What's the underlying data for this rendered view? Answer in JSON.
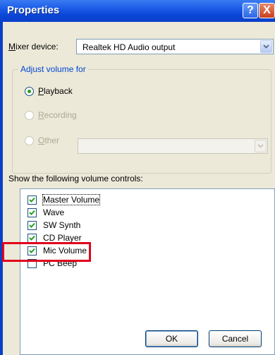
{
  "window": {
    "title": "Properties",
    "help_label": "?",
    "close_label": "X"
  },
  "mixer": {
    "label_underlined": "M",
    "label_rest": "ixer device:",
    "value": "Realtek HD Audio output"
  },
  "adjust_group": {
    "legend": "Adjust volume for",
    "playback": {
      "underlined": "P",
      "rest": "layback",
      "selected": true
    },
    "recording": {
      "underlined": "R",
      "rest": "ecording",
      "enabled": false
    },
    "other": {
      "underlined": "O",
      "rest": "ther",
      "enabled": false
    }
  },
  "controls": {
    "label": "Show the following volume controls:",
    "items": [
      {
        "label": "Master Volume",
        "checked": true
      },
      {
        "label": "Wave",
        "checked": true
      },
      {
        "label": "SW Synth",
        "checked": true
      },
      {
        "label": "CD Player",
        "checked": true
      },
      {
        "label": "Mic Volume",
        "checked": true
      },
      {
        "label": "PC Beep",
        "checked": false
      }
    ]
  },
  "buttons": {
    "ok": "OK",
    "cancel": "Cancel"
  },
  "colors": {
    "title_bar": "#0a3fc8",
    "dialog_bg": "#ece9d8",
    "legend_text": "#0046d5",
    "highlight_box": "#e0001b",
    "check_green": "#21a121"
  }
}
